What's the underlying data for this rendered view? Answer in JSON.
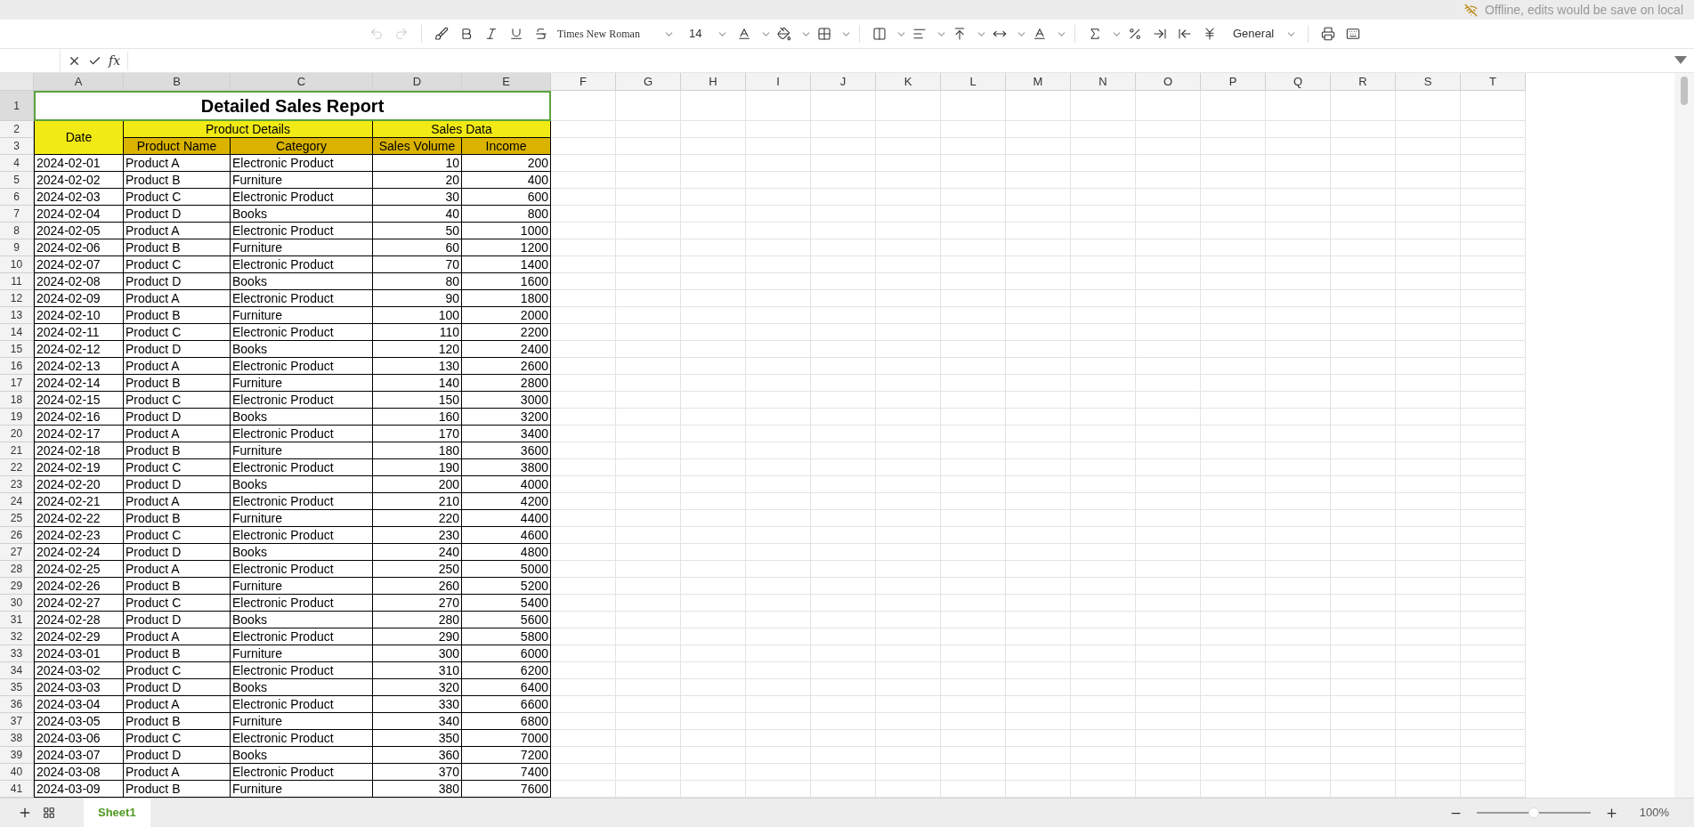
{
  "status": {
    "text": "Offline, edits would be save on local"
  },
  "toolbar": {
    "undo": {
      "disabled": true
    },
    "redo": {
      "disabled": true
    },
    "font": "Times New Roman",
    "font_size": "14",
    "number_format": "General"
  },
  "formula_bar": {
    "fx": "fx"
  },
  "columns": [
    {
      "label": "A",
      "selected": true
    },
    {
      "label": "B",
      "selected": true
    },
    {
      "label": "C",
      "selected": true
    },
    {
      "label": "D",
      "selected": true
    },
    {
      "label": "E",
      "selected": true
    },
    {
      "label": "F",
      "selected": false
    },
    {
      "label": "G",
      "selected": false
    },
    {
      "label": "H",
      "selected": false
    },
    {
      "label": "I",
      "selected": false
    },
    {
      "label": "J",
      "selected": false
    },
    {
      "label": "K",
      "selected": false
    },
    {
      "label": "L",
      "selected": false
    },
    {
      "label": "M",
      "selected": false
    },
    {
      "label": "N",
      "selected": false
    },
    {
      "label": "O",
      "selected": false
    },
    {
      "label": "P",
      "selected": false
    },
    {
      "label": "Q",
      "selected": false
    },
    {
      "label": "R",
      "selected": false
    },
    {
      "label": "S",
      "selected": false
    },
    {
      "label": "T",
      "selected": false
    }
  ],
  "row_headers": [
    {
      "label": "1",
      "selected": true
    },
    {
      "label": "2",
      "selected": false
    },
    {
      "label": "3",
      "selected": false
    },
    {
      "label": "4",
      "selected": false
    },
    {
      "label": "5",
      "selected": false
    },
    {
      "label": "6",
      "selected": false
    },
    {
      "label": "7",
      "selected": false
    },
    {
      "label": "8",
      "selected": false
    },
    {
      "label": "9",
      "selected": false
    },
    {
      "label": "10",
      "selected": false
    },
    {
      "label": "11",
      "selected": false
    },
    {
      "label": "12",
      "selected": false
    },
    {
      "label": "13",
      "selected": false
    },
    {
      "label": "14",
      "selected": false
    },
    {
      "label": "15",
      "selected": false
    },
    {
      "label": "16",
      "selected": false
    },
    {
      "label": "17",
      "selected": false
    },
    {
      "label": "18",
      "selected": false
    },
    {
      "label": "19",
      "selected": false
    },
    {
      "label": "20",
      "selected": false
    },
    {
      "label": "21",
      "selected": false
    },
    {
      "label": "22",
      "selected": false
    },
    {
      "label": "23",
      "selected": false
    },
    {
      "label": "24",
      "selected": false
    },
    {
      "label": "25",
      "selected": false
    },
    {
      "label": "26",
      "selected": false
    },
    {
      "label": "27",
      "selected": false
    },
    {
      "label": "28",
      "selected": false
    },
    {
      "label": "29",
      "selected": false
    },
    {
      "label": "30",
      "selected": false
    },
    {
      "label": "31",
      "selected": false
    },
    {
      "label": "32",
      "selected": false
    },
    {
      "label": "33",
      "selected": false
    },
    {
      "label": "34",
      "selected": false
    },
    {
      "label": "35",
      "selected": false
    },
    {
      "label": "36",
      "selected": false
    },
    {
      "label": "37",
      "selected": false
    },
    {
      "label": "38",
      "selected": false
    },
    {
      "label": "39",
      "selected": false
    },
    {
      "label": "40",
      "selected": false
    },
    {
      "label": "41",
      "selected": false
    }
  ],
  "report": {
    "title": "Detailed Sales Report",
    "date_header": "Date",
    "group_headers": [
      "Product Details",
      "Sales Data"
    ],
    "column_headers": [
      "Product Name",
      "Category",
      "Sales Volume",
      "Income"
    ],
    "rows": [
      [
        "2024-02-01",
        "Product A",
        "Electronic Product",
        "10",
        "200"
      ],
      [
        "2024-02-02",
        "Product B",
        "Furniture",
        "20",
        "400"
      ],
      [
        "2024-02-03",
        "Product C",
        "Electronic Product",
        "30",
        "600"
      ],
      [
        "2024-02-04",
        "Product D",
        "Books",
        "40",
        "800"
      ],
      [
        "2024-02-05",
        "Product A",
        "Electronic Product",
        "50",
        "1000"
      ],
      [
        "2024-02-06",
        "Product B",
        "Furniture",
        "60",
        "1200"
      ],
      [
        "2024-02-07",
        "Product C",
        "Electronic Product",
        "70",
        "1400"
      ],
      [
        "2024-02-08",
        "Product D",
        "Books",
        "80",
        "1600"
      ],
      [
        "2024-02-09",
        "Product A",
        "Electronic Product",
        "90",
        "1800"
      ],
      [
        "2024-02-10",
        "Product B",
        "Furniture",
        "100",
        "2000"
      ],
      [
        "2024-02-11",
        "Product C",
        "Electronic Product",
        "110",
        "2200"
      ],
      [
        "2024-02-12",
        "Product D",
        "Books",
        "120",
        "2400"
      ],
      [
        "2024-02-13",
        "Product A",
        "Electronic Product",
        "130",
        "2600"
      ],
      [
        "2024-02-14",
        "Product B",
        "Furniture",
        "140",
        "2800"
      ],
      [
        "2024-02-15",
        "Product C",
        "Electronic Product",
        "150",
        "3000"
      ],
      [
        "2024-02-16",
        "Product D",
        "Books",
        "160",
        "3200"
      ],
      [
        "2024-02-17",
        "Product A",
        "Electronic Product",
        "170",
        "3400"
      ],
      [
        "2024-02-18",
        "Product B",
        "Furniture",
        "180",
        "3600"
      ],
      [
        "2024-02-19",
        "Product C",
        "Electronic Product",
        "190",
        "3800"
      ],
      [
        "2024-02-20",
        "Product D",
        "Books",
        "200",
        "4000"
      ],
      [
        "2024-02-21",
        "Product A",
        "Electronic Product",
        "210",
        "4200"
      ],
      [
        "2024-02-22",
        "Product B",
        "Furniture",
        "220",
        "4400"
      ],
      [
        "2024-02-23",
        "Product C",
        "Electronic Product",
        "230",
        "4600"
      ],
      [
        "2024-02-24",
        "Product D",
        "Books",
        "240",
        "4800"
      ],
      [
        "2024-02-25",
        "Product A",
        "Electronic Product",
        "250",
        "5000"
      ],
      [
        "2024-02-26",
        "Product B",
        "Furniture",
        "260",
        "5200"
      ],
      [
        "2024-02-27",
        "Product C",
        "Electronic Product",
        "270",
        "5400"
      ],
      [
        "2024-02-28",
        "Product D",
        "Books",
        "280",
        "5600"
      ],
      [
        "2024-02-29",
        "Product A",
        "Electronic Product",
        "290",
        "5800"
      ],
      [
        "2024-03-01",
        "Product B",
        "Furniture",
        "300",
        "6000"
      ],
      [
        "2024-03-02",
        "Product C",
        "Electronic Product",
        "310",
        "6200"
      ],
      [
        "2024-03-03",
        "Product D",
        "Books",
        "320",
        "6400"
      ],
      [
        "2024-03-04",
        "Product A",
        "Electronic Product",
        "330",
        "6600"
      ],
      [
        "2024-03-05",
        "Product B",
        "Furniture",
        "340",
        "6800"
      ],
      [
        "2024-03-06",
        "Product C",
        "Electronic Product",
        "350",
        "7000"
      ],
      [
        "2024-03-07",
        "Product D",
        "Books",
        "360",
        "7200"
      ],
      [
        "2024-03-08",
        "Product A",
        "Electronic Product",
        "370",
        "7400"
      ],
      [
        "2024-03-09",
        "Product B",
        "Furniture",
        "380",
        "7600"
      ]
    ]
  },
  "sheet_tabs": [
    {
      "label": "Sheet1",
      "selected": true
    }
  ],
  "zoom": {
    "level": 0.5,
    "reading": "100%"
  }
}
